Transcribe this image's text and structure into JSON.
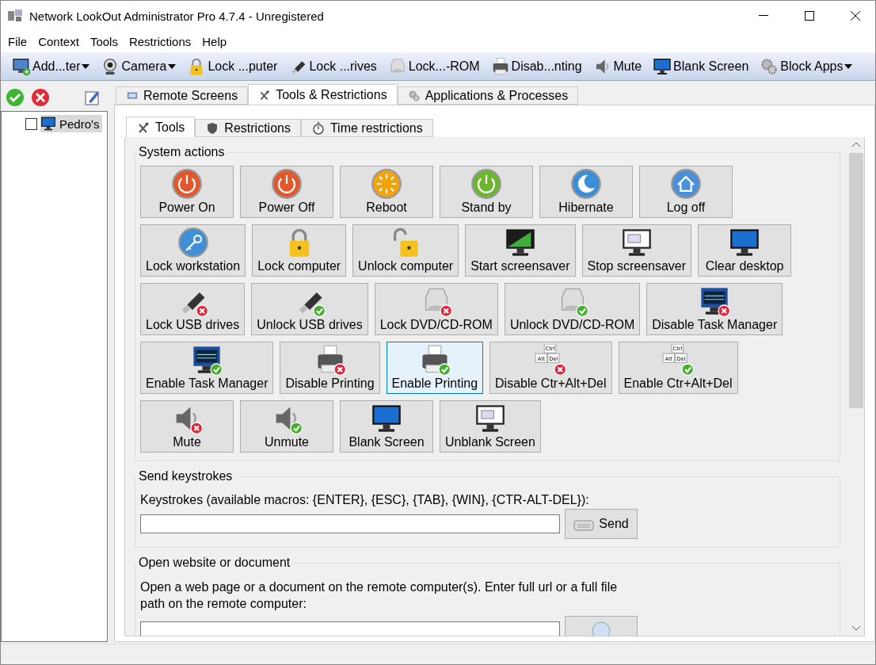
{
  "window": {
    "title": "Network LookOut Administrator Pro 4.7.4 - Unregistered"
  },
  "menu": [
    "File",
    "Context",
    "Tools",
    "Restrictions",
    "Help"
  ],
  "toolbar": [
    {
      "kind": "add",
      "label": "Add...ter",
      "dropdown": true
    },
    {
      "kind": "camera",
      "label": "Camera",
      "dropdown": true
    },
    {
      "kind": "lock",
      "label": "Lock ...puter",
      "dropdown": false
    },
    {
      "kind": "usb",
      "label": "Lock ...rives",
      "dropdown": false
    },
    {
      "kind": "disc",
      "label": "Lock...-ROM",
      "dropdown": false
    },
    {
      "kind": "printer",
      "label": "Disab...nting",
      "dropdown": false
    },
    {
      "kind": "speaker",
      "label": "Mute",
      "dropdown": false
    },
    {
      "kind": "monitor",
      "label": "Blank Screen",
      "dropdown": false
    },
    {
      "kind": "gears",
      "label": "Block Apps",
      "dropdown": true
    }
  ],
  "sidebar": {
    "items": [
      {
        "label": "Pedro's",
        "checked": false,
        "selected": true
      }
    ]
  },
  "tabs": [
    {
      "label": "Remote Screens",
      "selected": false,
      "kind": "screens"
    },
    {
      "label": "Tools & Restrictions",
      "selected": true,
      "kind": "tools"
    },
    {
      "label": "Applications & Processes",
      "selected": false,
      "kind": "gears"
    }
  ],
  "subtabs": [
    {
      "label": "Tools",
      "selected": true,
      "kind": "tools"
    },
    {
      "label": "Restrictions",
      "selected": false,
      "kind": "shield"
    },
    {
      "label": "Time restrictions",
      "selected": false,
      "kind": "stopwatch"
    }
  ],
  "system_actions": {
    "title": "System actions",
    "groups": [
      {
        "buttons": [
          {
            "label": "Power On",
            "kind": "power",
            "focused": false
          },
          {
            "label": "Power Off",
            "kind": "power",
            "focused": false
          },
          {
            "label": "Reboot",
            "kind": "reboot",
            "focused": false
          },
          {
            "label": "Stand by",
            "kind": "standby",
            "focused": false
          },
          {
            "label": "Hibernate",
            "kind": "hibernate",
            "focused": false
          },
          {
            "label": "Log off",
            "kind": "home",
            "focused": false
          }
        ]
      },
      {
        "buttons": [
          {
            "label": "Lock workstation",
            "kind": "key",
            "focused": false
          },
          {
            "label": "Lock computer",
            "kind": "lock",
            "focused": false
          },
          {
            "label": "Unlock computer",
            "kind": "unlock",
            "focused": false
          },
          {
            "label": "Start screensaver",
            "kind": "screensaver",
            "focused": false
          },
          {
            "label": "Stop screensaver",
            "kind": "window",
            "focused": false
          },
          {
            "label": "Clear desktop",
            "kind": "monitor",
            "focused": false
          }
        ]
      },
      {
        "buttons": [
          {
            "label": "Lock USB drives",
            "kind": "usb",
            "blocked": true,
            "focused": false
          },
          {
            "label": "Unlock USB drives",
            "kind": "usb",
            "blocked": false,
            "focused": false
          },
          {
            "label": "Lock DVD/CD-ROM",
            "kind": "disc",
            "blocked": true,
            "focused": false
          },
          {
            "label": "Unlock DVD/CD-ROM",
            "kind": "disc",
            "blocked": false,
            "focused": false
          },
          {
            "label": "Disable Task Manager",
            "kind": "taskmgr",
            "blocked": true,
            "focused": false
          }
        ]
      },
      {
        "buttons": [
          {
            "label": "Enable Task Manager",
            "kind": "taskmgr",
            "blocked": false,
            "focused": false
          },
          {
            "label": "Disable Printing",
            "kind": "printer",
            "blocked": true,
            "focused": false
          },
          {
            "label": "Enable Printing",
            "kind": "printer",
            "blocked": false,
            "focused": true
          },
          {
            "label": "Disable Ctr+Alt+Del",
            "kind": "keys",
            "blocked": true,
            "focused": false,
            "keys": [
              "Ctrl",
              "Alt",
              "Del"
            ]
          },
          {
            "label": "Enable Ctr+Alt+Del",
            "kind": "keys",
            "blocked": false,
            "focused": false,
            "keys": [
              "Ctrl",
              "Alt",
              "Del"
            ]
          }
        ]
      },
      {
        "buttons": [
          {
            "label": "Mute",
            "kind": "speaker",
            "blocked": true,
            "focused": false
          },
          {
            "label": "Unmute",
            "kind": "speaker",
            "blocked": false,
            "focused": false
          },
          {
            "label": "Blank Screen",
            "kind": "monitor",
            "focused": false
          },
          {
            "label": "Unblank Screen",
            "kind": "window",
            "focused": false
          }
        ]
      }
    ]
  },
  "send_keystrokes": {
    "title": "Send keystrokes",
    "label": "Keystrokes (available macros: {ENTER}, {ESC}, {TAB}, {WIN}, {CTR-ALT-DEL}):",
    "button": "Send"
  },
  "open_website": {
    "title": "Open website or document",
    "label": "Open a web page or a document on the remote computer(s). Enter full url or a full file path on the remote computer:"
  }
}
